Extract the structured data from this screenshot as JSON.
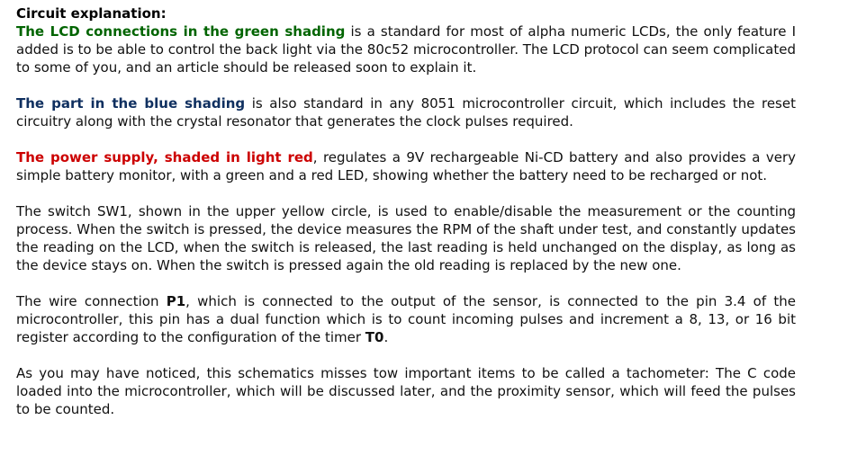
{
  "colors": {
    "green_highlight": "#006400",
    "blue_highlight": "#103060",
    "red_highlight": "#cc0000",
    "text": "#111111"
  },
  "heading": "Circuit explanation:",
  "paragraphs": {
    "lcd": {
      "highlight": "The LCD connections in the green shading",
      "text": " is a standard for most of alpha numeric LCDs, the only feature I added is to be able to control the back light via the 80c52 microcontroller. The LCD protocol can seem complicated to some of you, and an article should be released soon to explain it."
    },
    "blue": {
      "highlight": "The part in the blue shading",
      "text": " is also standard in any 8051 microcontroller circuit, which includes the reset circuitry along with the crystal resonator that generates the clock pulses required."
    },
    "power": {
      "highlight": "The power supply, shaded in light red",
      "text": ", regulates a 9V rechargeable Ni-CD battery and also provides a very simple battery monitor, with a green and a red LED, showing whether the battery need to be recharged or not."
    },
    "switch": {
      "text": "The switch SW1, shown in the upper yellow circle, is used to enable/disable the measurement or the counting process. When the switch is pressed, the device measures the RPM of the shaft under test, and constantly updates the reading on the LCD, when the switch is released, the last reading is held unchanged on the display, as long as the device stays on. When the switch is pressed again the old reading is replaced by the new one."
    },
    "wire": {
      "text_1": "The wire connection ",
      "bold_1": "P1",
      "text_2": ", which is connected to the output of the sensor, is connected to the pin 3.4 of the microcontroller, this pin has a dual function which is to count incoming pulses and increment a 8, 13, or 16 bit register according to the configuration of the timer ",
      "bold_2": "T0",
      "text_3": "."
    },
    "notice": {
      "text": "As you may have noticed, this schematics misses tow important items to be called a tachometer: The C code loaded into the microcontroller, which will be discussed later, and the proximity sensor, which will feed the pulses to be counted."
    }
  }
}
